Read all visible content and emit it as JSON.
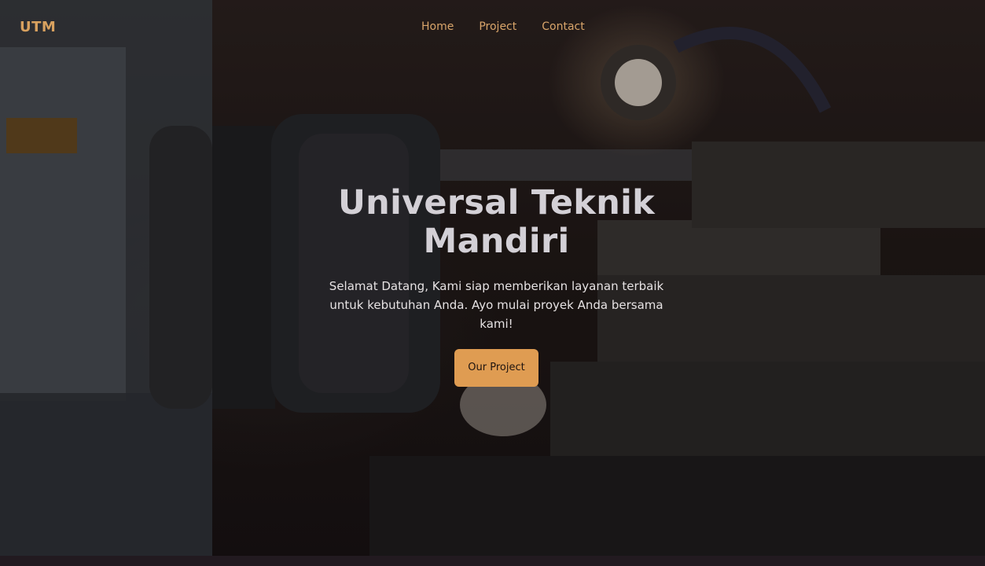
{
  "nav": {
    "brand": "UTM",
    "links": [
      "Home",
      "Project",
      "Contact"
    ]
  },
  "hero": {
    "title": "Universal Teknik Mandiri",
    "subtitle": "Selamat Datang, Kami siap memberikan layanan terbaik untuk kebutuhan Anda. Ayo mulai proyek Anda bersama kami!",
    "cta_label": "Our Project",
    "background": "lathe-machine-photo"
  },
  "colors": {
    "accent": "#df9c52",
    "nav_text": "#d9a56a",
    "title_text": "#d3d0d6",
    "background": "#1c1519"
  }
}
